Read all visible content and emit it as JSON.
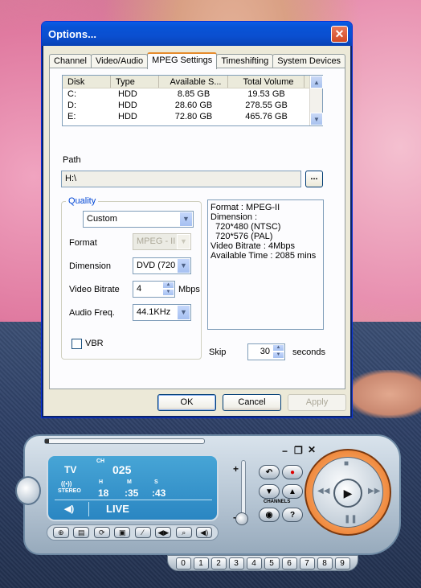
{
  "dialog": {
    "title": "Options...",
    "close_glyph": "✕",
    "tabs": [
      "Channel",
      "Video/Audio",
      "MPEG Settings",
      "Timeshifting",
      "System Devices"
    ],
    "active_tab": "MPEG Settings",
    "disk_table": {
      "columns": [
        "Disk",
        "Type",
        "Available S...",
        "Total Volume"
      ],
      "rows": [
        [
          "C:",
          "HDD",
          "8.85 GB",
          "19.53 GB"
        ],
        [
          "D:",
          "HDD",
          "28.60 GB",
          "278.55 GB"
        ],
        [
          "E:",
          "HDD",
          "72.80 GB",
          "465.76 GB"
        ]
      ]
    },
    "path_label": "Path",
    "path_value": "H:\\",
    "browse_label": "...",
    "quality": {
      "group_label": "Quality",
      "preset": "Custom",
      "format_label": "Format",
      "format_value": "MPEG - II",
      "dimension_label": "Dimension",
      "dimension_value": "DVD (720",
      "bitrate_label": "Video Bitrate",
      "bitrate_value": "4",
      "bitrate_unit": "Mbps",
      "audio_label": "Audio Freq.",
      "audio_value": "44.1KHz",
      "vbr_label": "VBR",
      "vbr_checked": false
    },
    "info": {
      "line1": "Format : MPEG-II",
      "line2": "Dimension :",
      "line3": "  720*480 (NTSC)",
      "line4": "  720*576 (PAL)",
      "line5": "Video Bitrate : 4Mbps",
      "line6": "Available Time : 2085 mins"
    },
    "skip_label": "Skip",
    "skip_value": "30",
    "skip_unit": "seconds",
    "ok_label": "OK",
    "cancel_label": "Cancel",
    "apply_label": "Apply"
  },
  "player": {
    "ch_label": "CH",
    "channel": "025",
    "source": "TV",
    "stereo_icon": "((•))",
    "stereo_label": "STEREO",
    "h_label": "H",
    "m_label": "M",
    "s_label": "S",
    "hours": "18",
    "minutes": ":35",
    "seconds": ":43",
    "mode": "LIVE",
    "volume_plus": "+",
    "volume_minus": "-",
    "channels_label": "CHANNELS",
    "channel_keys": [
      "0",
      "1",
      "2",
      "3",
      "4",
      "5",
      "6",
      "7",
      "8",
      "9"
    ],
    "volume_level": 0.15
  }
}
